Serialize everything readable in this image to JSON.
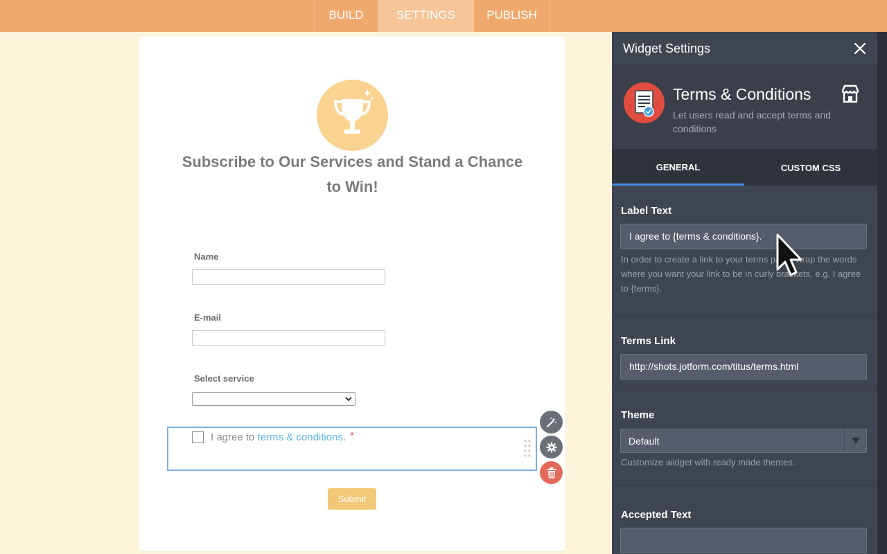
{
  "nav": {
    "tabs": [
      {
        "label": "BUILD"
      },
      {
        "label": "SETTINGS",
        "active": true
      },
      {
        "label": "PUBLISH"
      }
    ]
  },
  "form": {
    "logo_icon": "trophy-icon",
    "title": "Subscribe to Our Services and Stand a Chance to Win!",
    "fields": [
      {
        "label": "Name",
        "value": ""
      },
      {
        "label": "E-mail",
        "value": ""
      },
      {
        "label": "Select service",
        "selected": ""
      }
    ],
    "terms": {
      "prefix": "I agree to ",
      "link_text": "terms & conditions",
      "suffix": ".",
      "required_mark": "*",
      "checked": false
    },
    "submit_label": "Submit"
  },
  "panel": {
    "title": "Widget Settings",
    "widget": {
      "name": "Terms & Conditions",
      "description": "Let users read and accept terms and conditions"
    },
    "tabs": [
      {
        "label": "GENERAL",
        "active": true
      },
      {
        "label": "CUSTOM CSS"
      }
    ],
    "label_text": {
      "title": "Label Text",
      "value": "I agree to {terms & conditions}.",
      "help": "In order to create a link to your terms page, wrap the words where you want your link to be in curly brackets. e.g. I agree to {terms}."
    },
    "terms_link": {
      "title": "Terms Link",
      "value": "http://shots.jotform.com/titus/terms.html"
    },
    "theme": {
      "title": "Theme",
      "value": "Default",
      "help": "Customize widget with ready made themes."
    },
    "accepted_text": {
      "title": "Accepted Text",
      "value": ""
    }
  },
  "colors": {
    "nav_bg": "#f0a96d",
    "page_bg": "#fdf4dc",
    "panel_bg": "#3f4451",
    "accent_blue": "#3f8be0",
    "link": "#5bb6e6",
    "danger": "#e36a5b",
    "submit": "#f0c877"
  }
}
